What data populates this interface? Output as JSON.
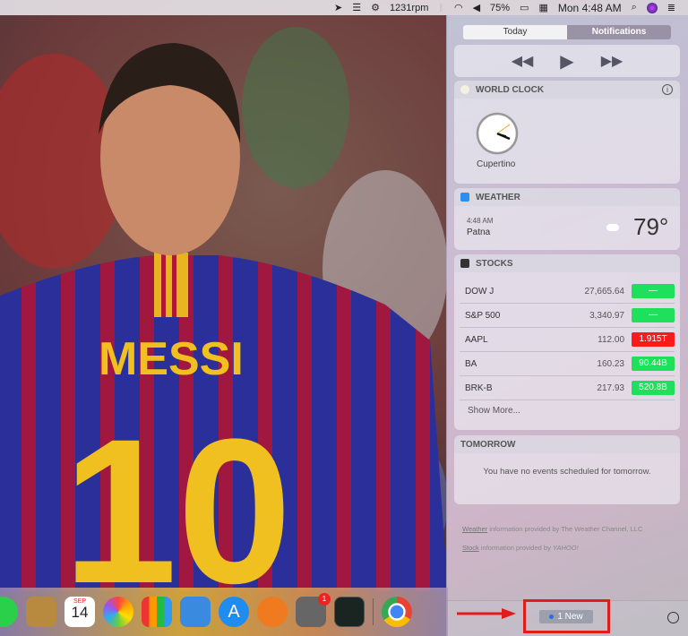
{
  "menubar": {
    "fan": "1231rpm",
    "battery": "75%",
    "clock": "Mon 4:48 AM"
  },
  "tabs": {
    "today": "Today",
    "notifications": "Notifications"
  },
  "world_clock": {
    "title": "WORLD CLOCK",
    "city": "Cupertino"
  },
  "weather": {
    "title": "WEATHER",
    "time": "4:48 AM",
    "city": "Patna",
    "temp": "79°"
  },
  "stocks": {
    "title": "STOCKS",
    "rows": [
      {
        "symbol": "DOW J",
        "price": "27,665.64",
        "change": "—",
        "color": "#1ee05a"
      },
      {
        "symbol": "S&P 500",
        "price": "3,340.97",
        "change": "—",
        "color": "#1ee05a"
      },
      {
        "symbol": "AAPL",
        "price": "112.00",
        "change": "1.915T",
        "color": "#ff1a1a"
      },
      {
        "symbol": "BA",
        "price": "160.23",
        "change": "90.44B",
        "color": "#1ee05a"
      },
      {
        "symbol": "BRK-B",
        "price": "217.93",
        "change": "520.8B",
        "color": "#1ee05a"
      }
    ],
    "show_more": "Show More..."
  },
  "tomorrow": {
    "title": "TOMORROW",
    "message": "You have no events scheduled for tomorrow."
  },
  "credits": {
    "weather_link": "Weather",
    "weather_text": "information provided by The Weather Channel, LLC",
    "stock_link": "Stock",
    "stock_text": "information provided by",
    "yahoo": "YAHOO!"
  },
  "bottom": {
    "new_label": "1 New"
  },
  "wallpaper": {
    "name": "MESSI",
    "number": "10"
  },
  "dock": {
    "calendar_month": "SEP",
    "calendar_day": "14",
    "prefs_badge": "1"
  }
}
